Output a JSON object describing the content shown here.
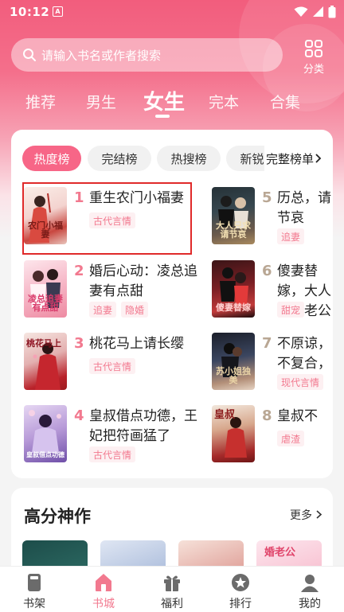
{
  "status_bar": {
    "time": "10:12",
    "notification_badge": "A"
  },
  "search": {
    "placeholder": "请输入书名或作者搜索"
  },
  "category_button": {
    "label": "分类"
  },
  "channel_tabs": [
    {
      "label": "推荐",
      "active": false
    },
    {
      "label": "男生",
      "active": false
    },
    {
      "label": "女生",
      "active": true
    },
    {
      "label": "完本",
      "active": false
    },
    {
      "label": "合集",
      "active": false
    }
  ],
  "ranking": {
    "chips": [
      {
        "label": "热度榜",
        "active": true
      },
      {
        "label": "完结榜",
        "active": false
      },
      {
        "label": "热搜榜",
        "active": false
      },
      {
        "label": "新锐榜",
        "active": false
      }
    ],
    "full_list_label": "完整榜单",
    "books": [
      {
        "rank": "1",
        "title": "重生农门小福妻",
        "tags": [
          "古代言情"
        ],
        "cover_text": "农门小福妻"
      },
      {
        "rank": "2",
        "title": "婚后心动：凌总追妻有点甜",
        "tags": [
          "追妻",
          "隐婚"
        ],
        "cover_text": "凌总追妻有点甜"
      },
      {
        "rank": "3",
        "title": "桃花马上请长缨",
        "tags": [
          "古代言情"
        ],
        "cover_text": "桃花马上"
      },
      {
        "rank": "4",
        "title": "皇叔借点功德，王妃把符画猛了",
        "tags": [
          "古代言情"
        ],
        "cover_text": "皇叔借点功德"
      },
      {
        "rank": "5",
        "title": "历总，请节哀",
        "tags": [
          "追妻"
        ],
        "cover_text": "大人只求请节哀"
      },
      {
        "rank": "6",
        "title": "傻妻替嫁，大人物人老公",
        "tags": [
          "甜宠"
        ],
        "cover_text": "傻妻替嫁"
      },
      {
        "rank": "7",
        "title": "不原谅，不复合，苏小姐",
        "tags": [
          "现代言情"
        ],
        "cover_text": "苏小姐独美"
      },
      {
        "rank": "8",
        "title": "皇叔不",
        "tags": [
          "虐渣"
        ],
        "cover_text": "皇叔"
      }
    ]
  },
  "high_score": {
    "title": "高分神作",
    "more_label": "更多",
    "peek_cover_text": "婚老公"
  },
  "bottom_nav": [
    {
      "label": "书架",
      "icon": "bookshelf-icon",
      "active": false
    },
    {
      "label": "书城",
      "icon": "store-icon",
      "active": true
    },
    {
      "label": "福利",
      "icon": "gift-icon",
      "active": false
    },
    {
      "label": "排行",
      "icon": "ranking-icon",
      "active": false
    },
    {
      "label": "我的",
      "icon": "profile-icon",
      "active": false
    }
  ],
  "colors": {
    "accent": "#f2798f",
    "chip_active": "#f76687",
    "header_top": "#f25d7d",
    "highlight_box": "#e02a2a"
  }
}
